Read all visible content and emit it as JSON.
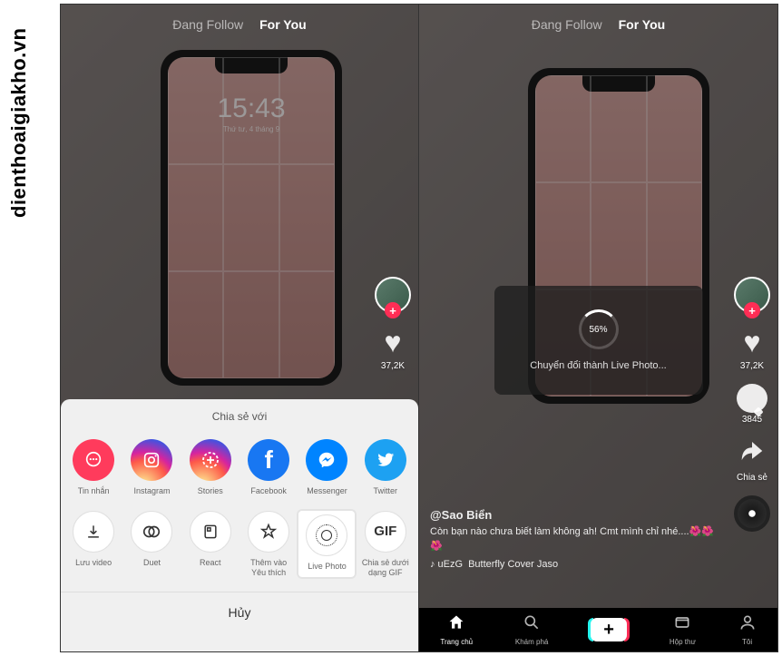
{
  "watermark": "dienthoaigiakho.vn",
  "tabs": {
    "following": "Đang Follow",
    "foryou": "For You"
  },
  "phone": {
    "time": "15:43",
    "date": "Thứ tư, 4 tháng 9"
  },
  "side": {
    "likes": "37,2K",
    "comments": "3845",
    "share_label": "Chia sẻ"
  },
  "share": {
    "title": "Chia sẻ với",
    "row1": {
      "messages": "Tin nhắn",
      "instagram": "Instagram",
      "stories": "Stories",
      "facebook": "Facebook",
      "messenger": "Messenger",
      "twitter": "Twitter"
    },
    "row2": {
      "save": "Lưu video",
      "duet": "Duet",
      "react": "React",
      "favorite": "Thêm vào\nYêu thích",
      "livephoto": "Live Photo",
      "gif": "Chia sẻ dưới\ndạng GIF",
      "gif_icon": "GIF"
    },
    "cancel": "Hủy"
  },
  "progress": {
    "percent": "56%",
    "text": "Chuyển đổi thành Live Photo..."
  },
  "caption": {
    "user": "@Sao Biển",
    "text": "Còn bạn nào chưa biết làm không ah! Cmt mình chỉ nhé....🌺🌺🌺",
    "music_prefix": "♪ uEzG",
    "music": "Butterfly Cover Jaso"
  },
  "nav": {
    "home": "Trang chủ",
    "discover": "Khám phá",
    "inbox": "Hộp thư",
    "me": "Tôi"
  }
}
